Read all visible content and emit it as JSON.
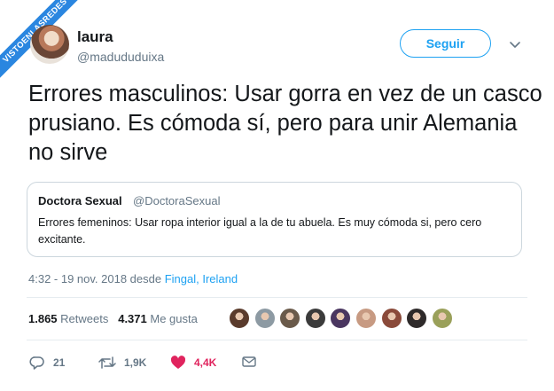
{
  "watermark": "VISTOENLASREDES",
  "author": {
    "name": "laura",
    "handle": "@madududuixa"
  },
  "follow_label": "Seguir",
  "tweet_text": "Errores masculinos: Usar gorra en vez de un casco prusiano. Es cómoda sí, pero para unir Alemania no sirve",
  "quoted": {
    "name": "Doctora Sexual",
    "handle": "@DoctoraSexual",
    "text": "Errores femeninos: Usar ropa interior igual a la de tu abuela. Es muy cómoda si, pero cero excitante."
  },
  "meta": {
    "datetime": "4:32 - 19 nov. 2018 desde ",
    "location": "Fingal, Ireland"
  },
  "stats": {
    "retweets_count": "1.865",
    "retweets_label": "Retweets",
    "likes_count": "4.371",
    "likes_label": "Me gusta"
  },
  "liker_avatar_colors": [
    "#5a3b2c",
    "#8d9aa3",
    "#6a5a4a",
    "#3b3b3b",
    "#4a3660",
    "#c79a82",
    "#8a4a3a",
    "#2e2a2a",
    "#9aa05a"
  ],
  "actions": {
    "replies": "21",
    "retweets": "1,9K",
    "likes": "4,4K"
  },
  "colors": {
    "accent": "#1da1f2",
    "like": "#e0245e",
    "muted": "#657786",
    "text": "#14171a"
  }
}
